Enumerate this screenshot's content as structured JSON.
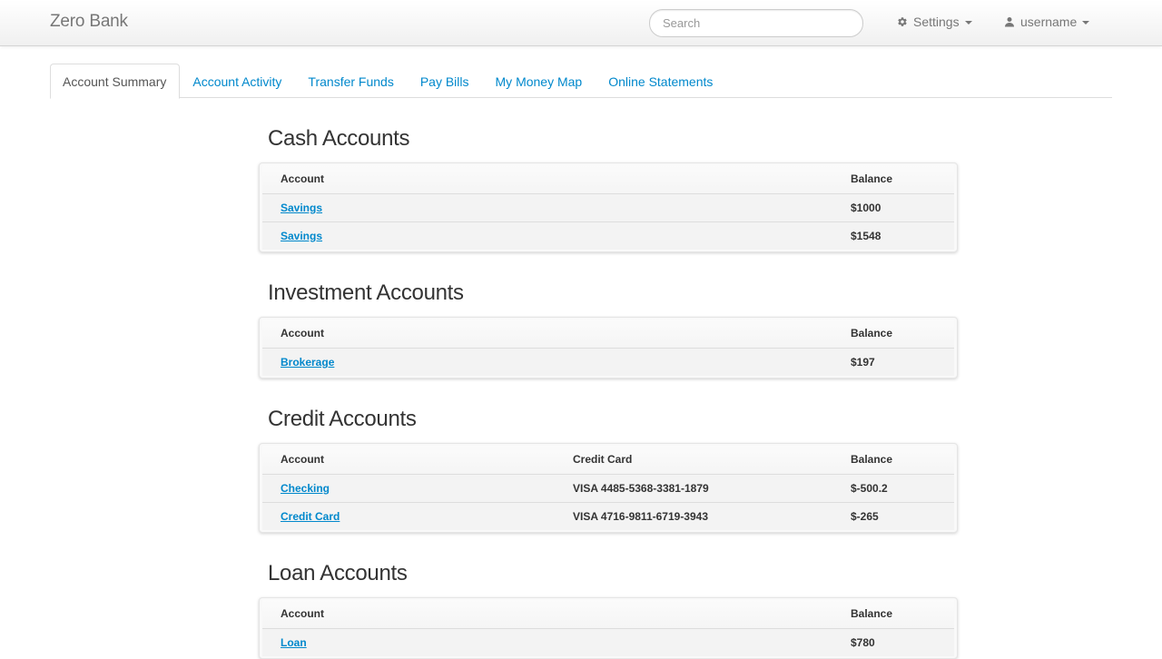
{
  "brand": "Zero Bank",
  "search": {
    "placeholder": "Search",
    "value": ""
  },
  "settings": {
    "label": "Settings",
    "icon": "gear-icon"
  },
  "user": {
    "label": "username",
    "icon": "user-icon"
  },
  "tabs": [
    {
      "label": "Account Summary",
      "active": true
    },
    {
      "label": "Account Activity",
      "active": false
    },
    {
      "label": "Transfer Funds",
      "active": false
    },
    {
      "label": "Pay Bills",
      "active": false
    },
    {
      "label": "My Money Map",
      "active": false
    },
    {
      "label": "Online Statements",
      "active": false
    }
  ],
  "colors": {
    "link": "#0088cc",
    "text": "#333333",
    "muted": "#777777"
  },
  "sections": {
    "cash": {
      "title": "Cash Accounts",
      "headers": {
        "account": "Account",
        "balance": "Balance"
      },
      "rows": [
        {
          "account": "Savings",
          "balance": "$1000"
        },
        {
          "account": "Savings",
          "balance": "$1548"
        }
      ]
    },
    "investment": {
      "title": "Investment Accounts",
      "headers": {
        "account": "Account",
        "balance": "Balance"
      },
      "rows": [
        {
          "account": "Brokerage",
          "balance": "$197"
        }
      ]
    },
    "credit": {
      "title": "Credit Accounts",
      "headers": {
        "account": "Account",
        "card": "Credit Card",
        "balance": "Balance"
      },
      "rows": [
        {
          "account": "Checking",
          "card": "VISA 4485-5368-3381-1879",
          "balance": "$-500.2"
        },
        {
          "account": "Credit Card",
          "card": "VISA 4716-9811-6719-3943",
          "balance": "$-265"
        }
      ]
    },
    "loan": {
      "title": "Loan Accounts",
      "headers": {
        "account": "Account",
        "balance": "Balance"
      },
      "rows": [
        {
          "account": "Loan",
          "balance": "$780"
        }
      ]
    }
  }
}
